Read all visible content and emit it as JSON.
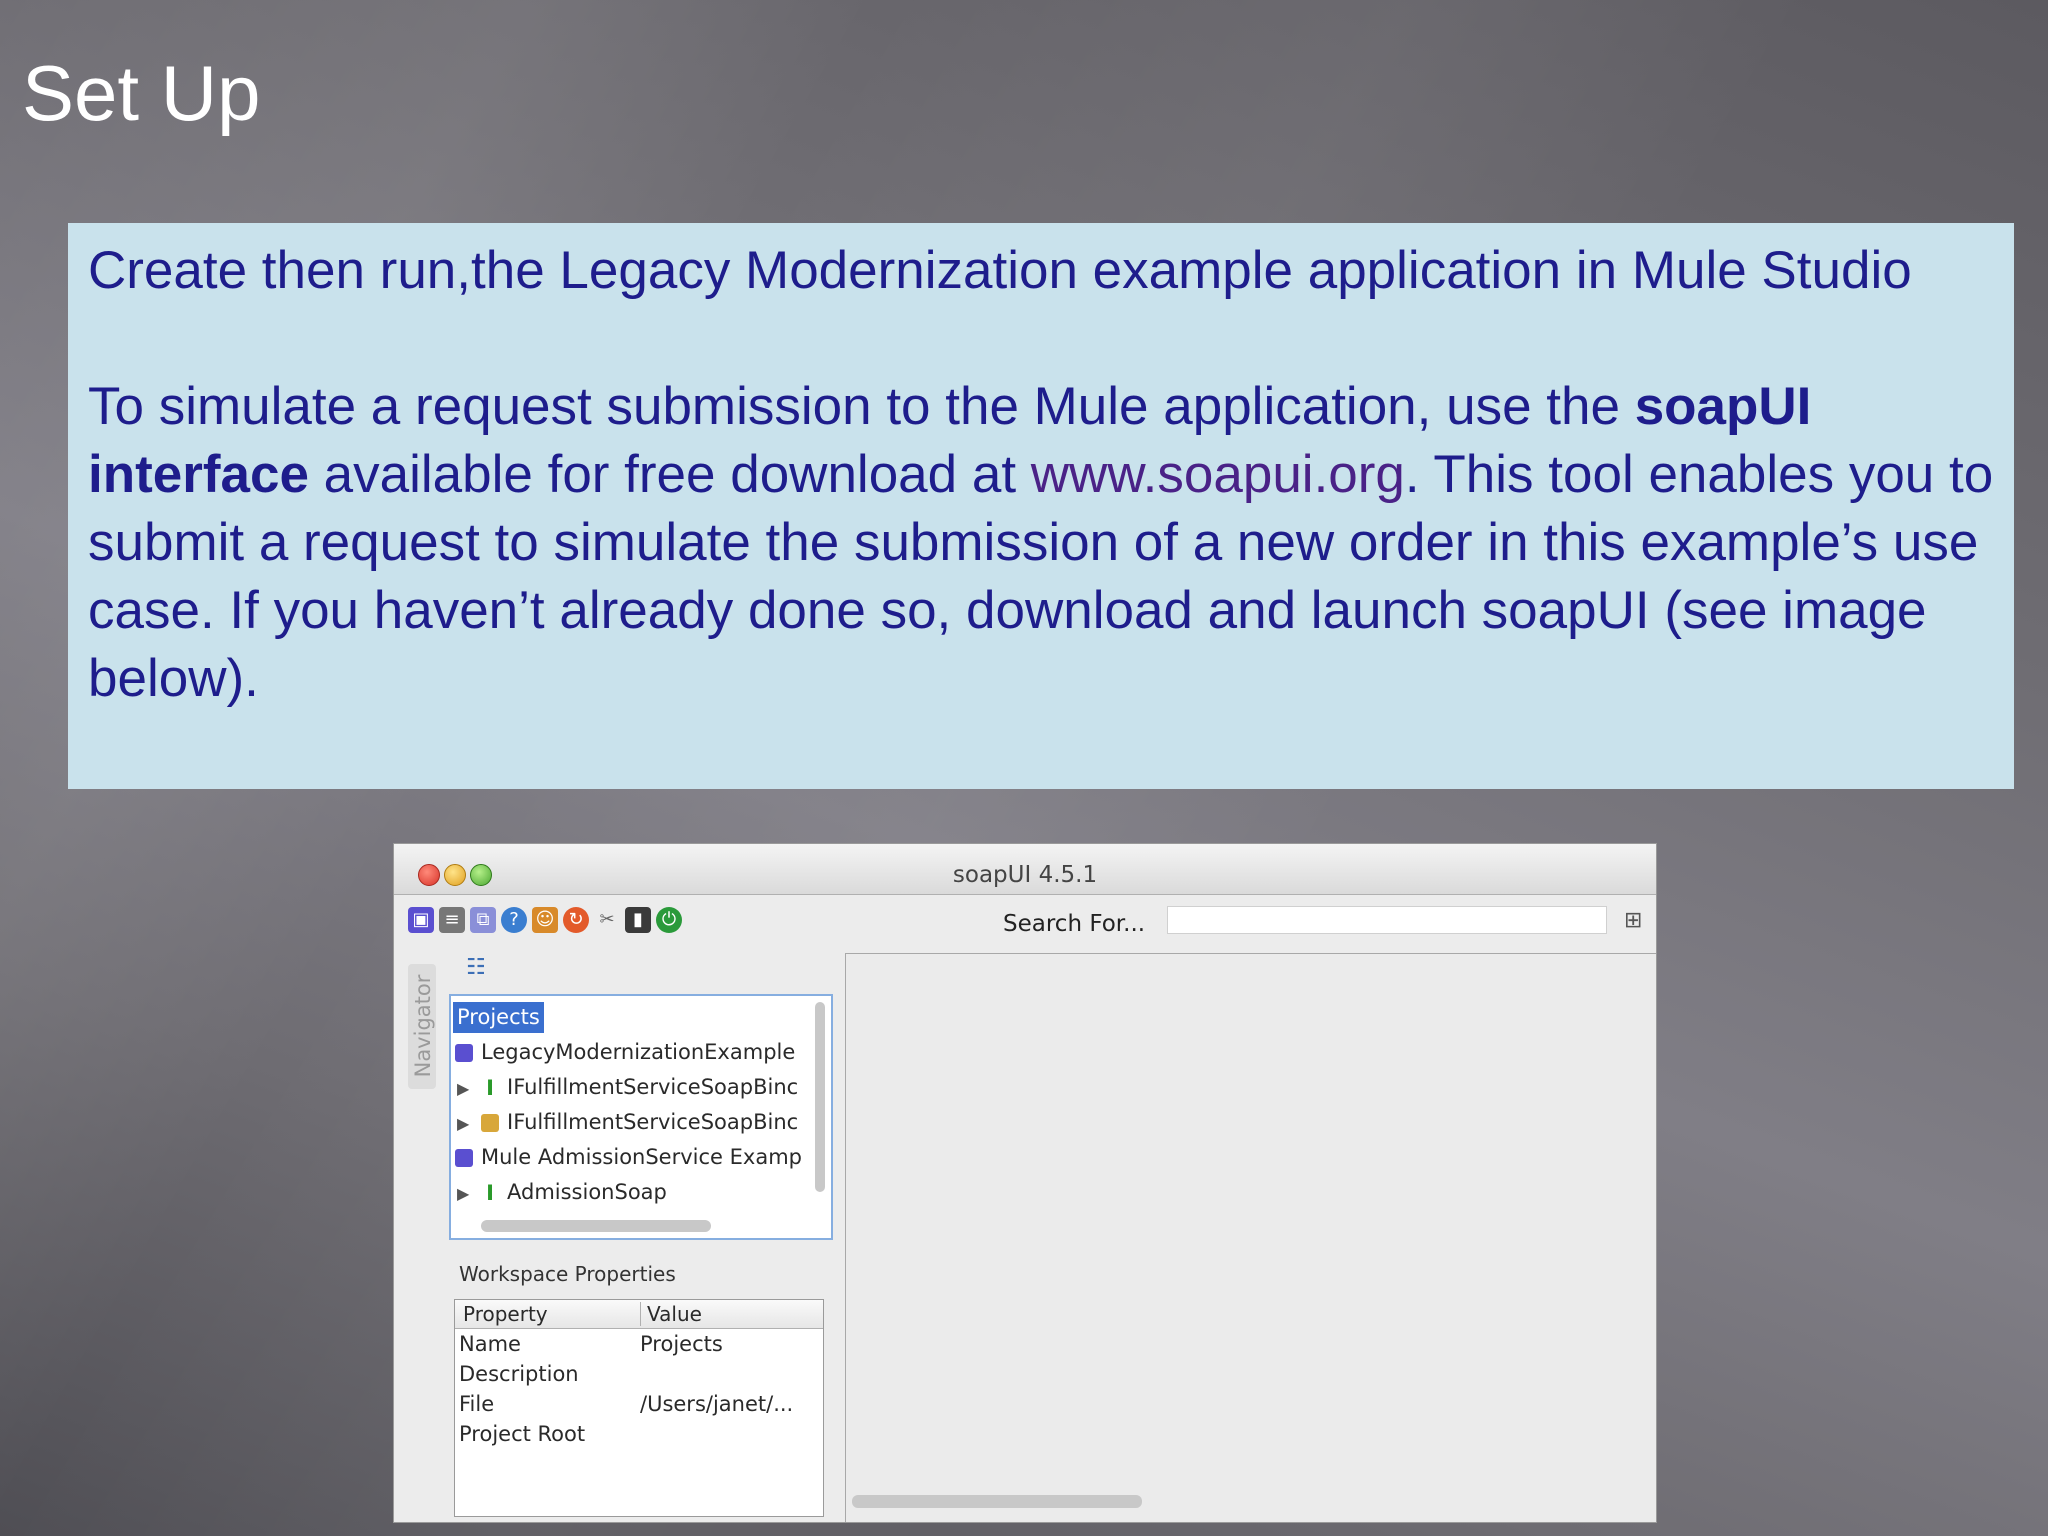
{
  "slide": {
    "title": "Set Up",
    "para1": "Create then run,the Legacy Modernization example application in Mule Studio",
    "para2_a": "To simulate a request submission to the Mule application, use the ",
    "para2_bold": "soapUI interface",
    "para2_b": " available for free download at ",
    "para2_link": "www.soapui.org",
    "para2_c": ". This tool enables you to submit a request to simulate the submission of a new order in this example’s use case.  If you haven’t already done so, download and launch soapUI (see image below)."
  },
  "soapui": {
    "window_title": "soapUI 4.5.1",
    "search_label": "Search For...",
    "navigator_label": "Navigator",
    "tree": {
      "root": "Projects",
      "items": [
        {
          "label": "LegacyModernizationExample",
          "icon": "project-icon"
        },
        {
          "label": "IFulfillmentServiceSoapBinc",
          "icon": "interface-icon"
        },
        {
          "label": "IFulfillmentServiceSoapBinc",
          "icon": "mock-icon"
        },
        {
          "label": "Mule AdmissionService Examp",
          "icon": "project-icon"
        },
        {
          "label": "AdmissionSoap",
          "icon": "interface-icon"
        }
      ]
    },
    "workspace_properties": {
      "title": "Workspace Properties",
      "headers": [
        "Property",
        "Value"
      ],
      "rows": [
        [
          "Name",
          "Projects"
        ],
        [
          "Description",
          ""
        ],
        [
          "File",
          "/Users/janet/..."
        ],
        [
          "Project Root",
          ""
        ]
      ]
    },
    "toolbar_icons": [
      "new-project-icon",
      "import-icon",
      "save-all-icon",
      "help-icon",
      "users-icon",
      "refresh-icon",
      "tools-icon",
      "mock-run-icon",
      "exit-icon"
    ]
  }
}
